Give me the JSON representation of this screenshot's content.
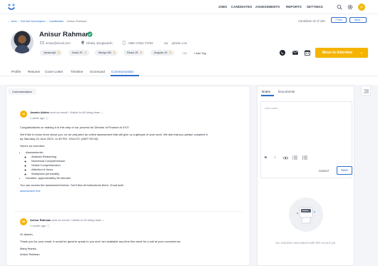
{
  "nav": {
    "links": [
      "JOBS",
      "CANDIDATES",
      "ASSESSMENTS",
      "REPORTS",
      "SETTINGS"
    ],
    "user_initials": "JT"
  },
  "breadcrumb": {
    "back": "Jobs",
    "job": "Dot Net Developers",
    "section": "Candidates",
    "current": "Anisur Rahman"
  },
  "pager": {
    "count_text": "Candidate 32 of 100",
    "prev_label": "Prev",
    "next_label": "Next"
  },
  "candidate": {
    "name": "Anisur Rahman",
    "email": "anisur@email.com",
    "location": "Dhaka, Bangladesh",
    "phone": "+880-17561-73793",
    "via": "via",
    "source": "jobsite.com",
    "tags": [
      "Javascript",
      "Node JS",
      "Mongo DB",
      "React JS",
      "Angular JS"
    ],
    "more_tags": "+13",
    "add_tag_label": "Add Tag"
  },
  "actions": {
    "move_label": "Move to Interview"
  },
  "tabs": [
    "Profile",
    "Resume",
    "Cover Letter",
    "Timeline",
    "Scorecard",
    "Communication"
  ],
  "communication": {
    "title": "Communication",
    "messages": [
      {
        "initials": "JA",
        "from": "Jasmin Akhter",
        "meta": "sent an email • Visible to",
        "audience": "All hiring team",
        "time": "1 week ago",
        "lines": [
          "Congratulations on making it to this step of our process for Director of Finance at XYZ!",
          "We'd like to know more about you, so we prepared an online assessment that will give us a glimpse of your work. We ask that you please complete it",
          "by Saturday 24 June 2023, 11:45 PM - Etc/UTC (GMT+00:00).",
          "Here's an overview:"
        ],
        "bullets": [
          "Assessments:",
          "Abstract Reasoning",
          "Numerical Comprehension",
          "Verbal Comprehension",
          "Attention & focus",
          "Workplace personality",
          "Duration: approximately 56 minutes"
        ],
        "closing": "You can access the assessment below. You'll find all instructions there. Good luck!",
        "link_text": "assessment link"
      },
      {
        "initials": "AR",
        "from": "Anisur Rahman",
        "meta": "sent an email • Visible to",
        "audience": "All hiring team",
        "time": "1 month ago",
        "lines": [
          "Hi Jasmin,",
          "Thank you for your email. It would be great to speak to you and I am available any time this week for a call at your convenience.",
          "Many thanks,",
          "Anisur Rahman"
        ]
      }
    ]
  },
  "notes": {
    "tabs": [
      "Notes",
      "Documents"
    ],
    "placeholder": "Add notes",
    "toolbar": [
      "B",
      "I",
      "link",
      "ol",
      "ul"
    ],
    "cancel_label": "Cancel",
    "save_label": "Save",
    "empty_text": "No activities associated with this record yet."
  },
  "colors": {
    "accent": "#2c6ecb",
    "primary_button": "#f5b400"
  }
}
